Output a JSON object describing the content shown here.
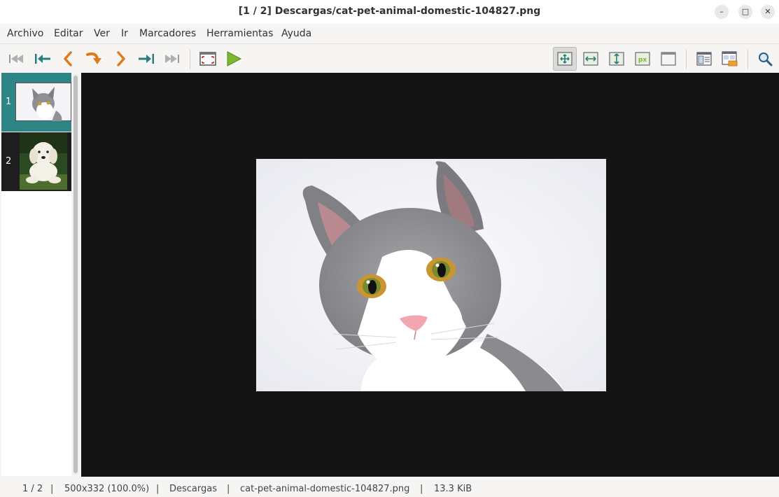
{
  "window": {
    "title": "[1 / 2]  Descargas/cat-pet-animal-domestic-104827.png",
    "minimize_label": "–",
    "maximize_label": "□",
    "close_label": "✕"
  },
  "menu": [
    "Archivo",
    "Editar",
    "Ver",
    "Ir",
    "Marcadores",
    "Herramientas",
    "Ayuda"
  ],
  "toolbar": {
    "icons": [
      "first-image-icon",
      "back-10-icon",
      "previous-icon",
      "rotate-icon",
      "next-icon",
      "forward-10-icon",
      "last-image-icon",
      "fullscreen-icon",
      "slideshow-play-icon",
      "fit-window-icon",
      "fit-width-icon",
      "fit-height-icon",
      "original-size-icon",
      "fullscreen-blank-icon",
      "thumbnails-toggle-icon",
      "browser-icon",
      "search-icon"
    ]
  },
  "thumbnails": [
    {
      "number": "1",
      "name": "cat-thumbnail"
    },
    {
      "number": "2",
      "name": "dog-thumbnail"
    }
  ],
  "status": {
    "position": "1 / 2",
    "dimensions": "500x332 (100.0%)",
    "folder": "Descargas",
    "filename": "cat-pet-animal-domestic-104827.png",
    "size": "13.3 KiB",
    "separator": "|"
  },
  "colors": {
    "selected_thumbnail_bg": "#2d8585",
    "viewer_bg": "#141414",
    "nav_orange": "#e07a1f",
    "nav_teal": "#2a7d7d",
    "play_green": "#7cb82f"
  }
}
